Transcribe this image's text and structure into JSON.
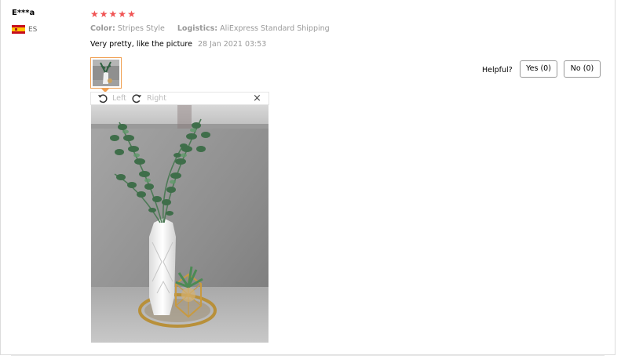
{
  "user": {
    "name": "E***a",
    "country_code": "ES",
    "rating": 5
  },
  "order": {
    "color_label": "Color:",
    "color_value": "Stripes Style",
    "logistics_label": "Logistics:",
    "logistics_value": "AliExpress Standard Shipping"
  },
  "review": {
    "text": "Very pretty, like the picture",
    "date": "28 Jan 2021 03:53"
  },
  "helpful": {
    "label": "Helpful?",
    "yes_label": "Yes (0)",
    "no_label": "No (0)"
  },
  "viewer": {
    "rotate_left_label": "Left",
    "rotate_right_label": "Right",
    "close_glyph": "×"
  },
  "icons": [
    "flag-es-icon",
    "star-icon",
    "rotate-left-icon",
    "rotate-right-icon",
    "close-icon"
  ],
  "colors": {
    "star": "#f05454",
    "thumb_border": "#f0a052"
  }
}
